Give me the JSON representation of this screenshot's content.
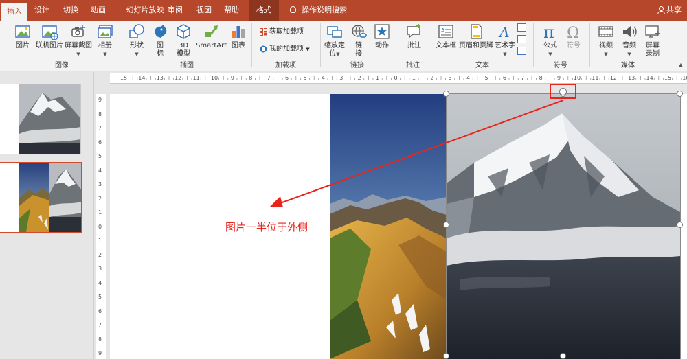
{
  "tabs": [
    {
      "label": "插入",
      "active": true
    },
    {
      "label": "设计"
    },
    {
      "label": "切换"
    },
    {
      "label": "动画"
    },
    {
      "label": "幻灯片放映"
    },
    {
      "label": "审阅"
    },
    {
      "label": "视图"
    },
    {
      "label": "帮助"
    },
    {
      "label": "格式"
    }
  ],
  "tell_me": "操作说明搜索",
  "share": "共享",
  "ribbon": {
    "images_group": {
      "label": "图像",
      "picture": "图片",
      "online_picture": "联机图片",
      "screenshot": "屏幕截图",
      "album": "相册"
    },
    "illustrations_group": {
      "label": "插图",
      "shapes": "形状",
      "icons_line1": "图",
      "icons_line2": "标",
      "model_line1": "3D",
      "model_line2": "模型",
      "smartart": "SmartArt",
      "chart": "图表"
    },
    "addins_group": {
      "label": "加载项",
      "get_addins": "获取加载项",
      "my_addins": "我的加载项"
    },
    "links_group": {
      "label": "链接",
      "zoom_line1": "缩放定",
      "zoom_line2": "位",
      "link_line1": "链",
      "link_line2": "接",
      "action": "动作"
    },
    "comments_group": {
      "label": "批注",
      "comment": "批注"
    },
    "text_group": {
      "label": "文本",
      "textbox": "文本框",
      "header_footer": "页眉和页脚",
      "wordart": "艺术字"
    },
    "symbols_group": {
      "label": "符号",
      "equation": "公式",
      "symbol": "符号"
    },
    "media_group": {
      "label": "媒体",
      "video": "视频",
      "audio": "音频",
      "screen_rec_line1": "屏幕",
      "screen_rec_line2": "录制"
    }
  },
  "rulers": {
    "h_labels": [
      "15",
      "14",
      "13",
      "12",
      "11",
      "10",
      "9",
      "8",
      "7",
      "6",
      "5",
      "4",
      "3",
      "2",
      "1",
      "0",
      "1",
      "2",
      "3",
      "4",
      "5",
      "6",
      "7",
      "8",
      "9",
      "10",
      "11",
      "12",
      "13",
      "14",
      "15",
      "16"
    ],
    "v_labels": [
      "9",
      "8",
      "7",
      "6",
      "5",
      "4",
      "3",
      "2",
      "1",
      "0",
      "1",
      "2",
      "3",
      "4",
      "5",
      "6",
      "7",
      "8",
      "9"
    ]
  },
  "annotation": "图片一半位于外侧",
  "colors": {
    "accent": "#b7472a",
    "annotation_red": "#e8251d"
  }
}
